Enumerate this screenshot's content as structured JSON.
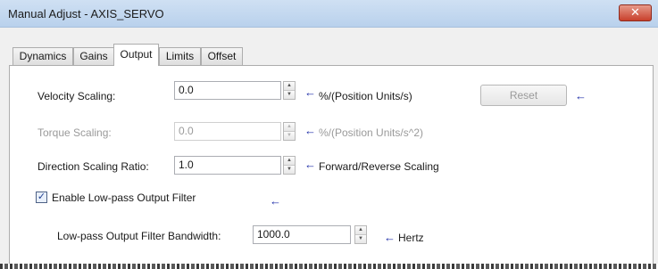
{
  "window": {
    "title": "Manual Adjust - AXIS_SERVO",
    "close_glyph": "✕"
  },
  "tabs": [
    {
      "label": "Dynamics",
      "active": false
    },
    {
      "label": "Gains",
      "active": false
    },
    {
      "label": "Output",
      "active": true
    },
    {
      "label": "Limits",
      "active": false
    },
    {
      "label": "Offset",
      "active": false
    }
  ],
  "output": {
    "velocity_scaling": {
      "label": "Velocity Scaling:",
      "value": "0.0",
      "unit": "%/(Position Units/s)"
    },
    "torque_scaling": {
      "label": "Torque Scaling:",
      "value": "0.0",
      "unit": "%/(Position Units/s^2)",
      "enabled": false
    },
    "direction_scaling_ratio": {
      "label": "Direction Scaling Ratio:",
      "value": "1.0",
      "unit": "Forward/Reverse Scaling"
    },
    "reset_label": "Reset",
    "lowpass_filter": {
      "label": "Enable Low-pass Output Filter",
      "checked": true,
      "check_glyph": "✓"
    },
    "lowpass_bandwidth": {
      "label": "Low-pass Output Filter Bandwidth:",
      "value": "1000.0",
      "unit": "Hertz"
    }
  },
  "glyphs": {
    "arrow": "←",
    "spin_up": "▲",
    "spin_down": "▼"
  },
  "colors": {
    "arrow": "#1f2ea8",
    "titlebar": "#c5d9f0",
    "close_button": "#c8402c"
  }
}
